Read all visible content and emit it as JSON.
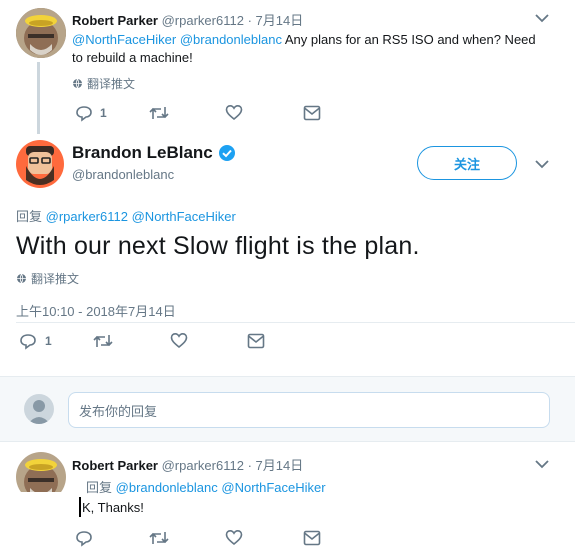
{
  "tweet1": {
    "name": "Robert Parker",
    "handle": "@rparker6112",
    "separator": "·",
    "date": "7月14日",
    "mention1": "@NorthFaceHiker",
    "mention2": "@brandonleblanc",
    "text_line1": " Any plans for an RS5 ISO and when? Need",
    "text_line2": "to rebuild a machine!",
    "translate": "翻译推文",
    "reply_count": "1"
  },
  "tweet2": {
    "name": "Brandon LeBlanc",
    "handle": "@brandonleblanc",
    "follow_label": "关注",
    "reply_prefix": "回复",
    "reply_mention1": "@rparker6112",
    "reply_mention2": "@NorthFaceHiker",
    "text": "With our next Slow flight is the plan.",
    "translate": "翻译推文",
    "timestamp": "上午10:10 - 2018年7月14日",
    "reply_count": "1"
  },
  "compose": {
    "placeholder": "发布你的回复"
  },
  "tweet3": {
    "name": "Robert Parker",
    "handle": "@rparker6112",
    "separator": "·",
    "date": "7月14日",
    "reply_prefix": "回复",
    "reply_mention1": "@brandonleblanc",
    "reply_mention2": "@NorthFaceHiker",
    "text": "K, Thanks!"
  },
  "colors": {
    "accent": "#1b95e0",
    "verified": "#1da1f2",
    "thread_line": "#ccd6dd",
    "compose_bg": "#f5f8fa"
  }
}
